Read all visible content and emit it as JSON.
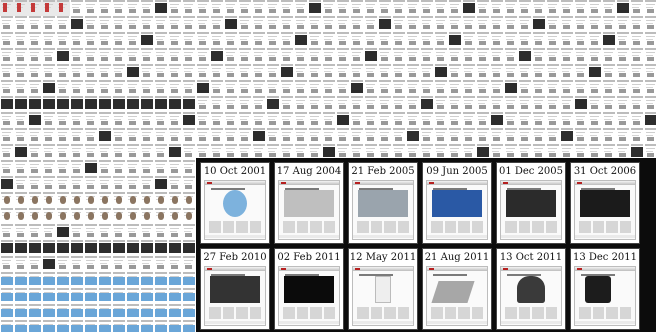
{
  "snapshots": [
    {
      "date": "10 Oct 2001",
      "hero": "x-disc",
      "color": "#7db2dd"
    },
    {
      "date": "17 Aug 2004",
      "hero": "imac",
      "color": "#bfbfbf"
    },
    {
      "date": "21 Feb 2005",
      "hero": "silver-box",
      "color": "#9aa4ad"
    },
    {
      "date": "09 Jun 2005",
      "hero": "blue-banner",
      "color": "#2a59a5"
    },
    {
      "date": "01 Dec 2005",
      "hero": "ipods",
      "color": "#2b2b2b"
    },
    {
      "date": "31 Oct 2006",
      "hero": "dark-banner",
      "color": "#1b1b1b"
    },
    {
      "date": "27 Feb 2010",
      "hero": "ipad",
      "color": "#333333"
    },
    {
      "date": "02 Feb 2011",
      "hero": "black-hero",
      "color": "#0b0b0b"
    },
    {
      "date": "12 May 2011",
      "hero": "ipod-white",
      "color": "#eeeeee"
    },
    {
      "date": "21 Aug 2011",
      "hero": "macbook-air",
      "color": "#a7a7a7"
    },
    {
      "date": "13 Oct 2011",
      "hero": "portrait",
      "color": "#3a3a3a"
    },
    {
      "date": "13 Dec 2011",
      "hero": "iphone",
      "color": "#1c1c1c"
    }
  ]
}
